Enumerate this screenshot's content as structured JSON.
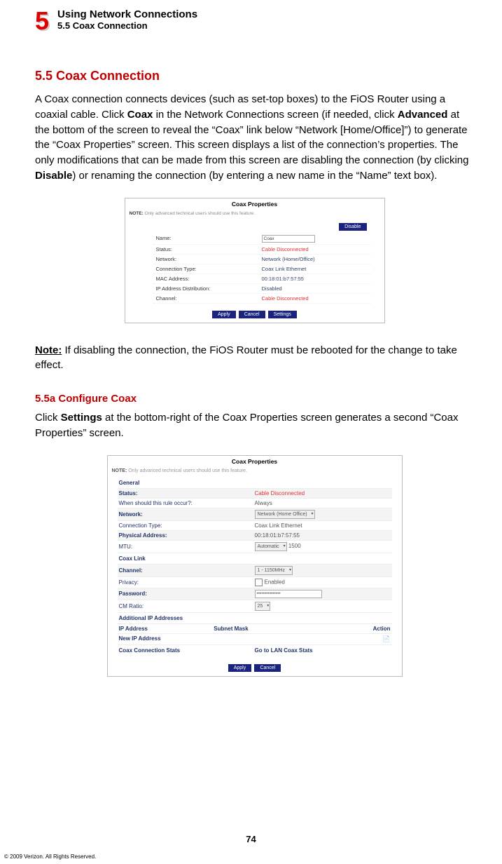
{
  "chapter": {
    "number": "5",
    "title": "Using Network Connections",
    "subtitle": "5.5  Coax Connection"
  },
  "section_heading": "5.5  Coax Connection",
  "para1_pre": "A Coax connection connects devices (such as set-top boxes) to the FiOS Router using a coaxial cable. Click ",
  "para1_b1": "Coax",
  "para1_mid1": " in the Network Connections screen (if needed, click ",
  "para1_b2": "Advanced",
  "para1_mid2": " at the bottom of the screen to reveal the “Coax” link below “Network [Home/Office]”) to generate the “Coax Properties” screen. This screen displays a list of the connection’s properties. The only modifications that can be made from this screen are disabling the connection (by clicking ",
  "para1_b3": "Disable",
  "para1_mid3": ") or renaming the connection (by entering a new name in the “Name” text box).",
  "shot1": {
    "title": "Coax Properties",
    "note_label": "NOTE:",
    "note_text": "Only advanced technical users should use this feature.",
    "disable_btn": "Disable",
    "rows": {
      "name_k": "Name:",
      "name_v": "Coax",
      "status_k": "Status:",
      "status_v": "Cable Disconnected",
      "network_k": "Network:",
      "network_v": "Network (Home/Office)",
      "conn_k": "Connection Type:",
      "conn_v": "Coax Link Ethernet",
      "mac_k": "MAC Address:",
      "mac_v": "00:18:01:b7:57:55",
      "ipd_k": "IP Address Distribution:",
      "ipd_v": "Disabled",
      "ch_k": "Channel:",
      "ch_v": "Cable Disconnected"
    },
    "btn_apply": "Apply",
    "btn_cancel": "Cancel",
    "btn_settings": "Settings"
  },
  "note": {
    "label": "Note:",
    "text": " If disabling the connection, the FiOS Router must be rebooted for the change to take effect."
  },
  "subsection_heading": "5.5a  Configure Coax",
  "para2_pre": "Click ",
  "para2_b1": "Settings",
  "para2_post": " at the bottom-right of the Coax Properties screen generates a second “Coax Properties” screen.",
  "shot2": {
    "title": "Coax Properties",
    "note_label": "NOTE:",
    "note_text": "Only advanced technical users should use this feature.",
    "general": "General",
    "status_k": "Status:",
    "status_v": "Cable Disconnected",
    "rule_k": "When should this rule occur?:",
    "rule_v": "Always",
    "network_k": "Network:",
    "network_v": "Network (Home Office)",
    "conn_k": "Connection Type:",
    "conn_v": "Coax Link Ethernet",
    "phys_k": "Physical Address:",
    "phys_v": "00:18:01:b7:57:55",
    "mtu_k": "MTU:",
    "mtu_sel": "Automatic",
    "mtu_val": "1500",
    "coaxlink": "Coax Link",
    "channel_k": "Channel:",
    "channel_v": "1 - 1150MHz",
    "privacy_k": "Privacy:",
    "privacy_v": "Enabled",
    "password_k": "Password:",
    "password_v": "•••••••••••••••",
    "cm_k": "CM Ratio:",
    "cm_v": "25",
    "addip_title": "Additional IP Addresses",
    "addip_col1": "IP Address",
    "addip_col2": "Subnet Mask",
    "addip_col3": "Action",
    "newip": "New IP Address",
    "action_icon": "📄",
    "stats_k": "Coax Connection Stats",
    "stats_v": "Go to LAN Coax Stats",
    "btn_apply": "Apply",
    "btn_cancel": "Cancel"
  },
  "page_number": "74",
  "copyright": "© 2009 Verizon. All Rights Reserved."
}
